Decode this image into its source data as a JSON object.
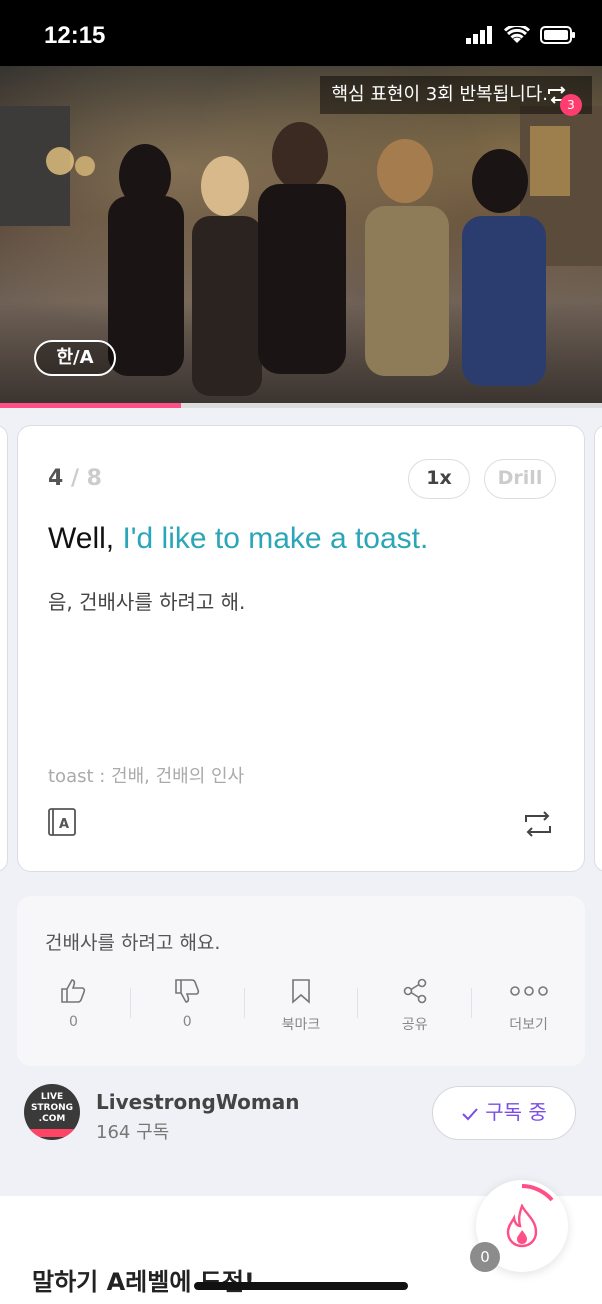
{
  "status": {
    "time": "12:15"
  },
  "video": {
    "repeat_banner": "핵심 표현이 3회 반복됩니다.",
    "repeat_count": "3",
    "lang_toggle": "한/A",
    "progress": 0.3
  },
  "card": {
    "index": "4",
    "total": "8",
    "speed_label": "1x",
    "drill_label": "Drill",
    "sentence_plain": "Well, ",
    "sentence_highlight": "I'd like to make a toast.",
    "translation": "음, 건배사를 하려고 해.",
    "vocab": "toast : 건배, 건배의 인사"
  },
  "comment": {
    "text": "건배사를 하려고 해요.",
    "actions": {
      "like_count": "0",
      "dislike_count": "0",
      "bookmark": "북마크",
      "share": "공유",
      "more": "더보기"
    }
  },
  "channel": {
    "avatar_text": [
      "LIVE",
      "STRONG",
      ".COM"
    ],
    "name": "LivestrongWoman",
    "subscribers": "164 구독",
    "subscribe_label": "구독 중"
  },
  "challenge": {
    "title": "말하기 A레벨에 도전!",
    "streak_count": "0"
  },
  "colors": {
    "accent_pink": "#ff4f86",
    "highlight_teal": "#2ba6b8",
    "subscribe_purple": "#7b4de8"
  }
}
